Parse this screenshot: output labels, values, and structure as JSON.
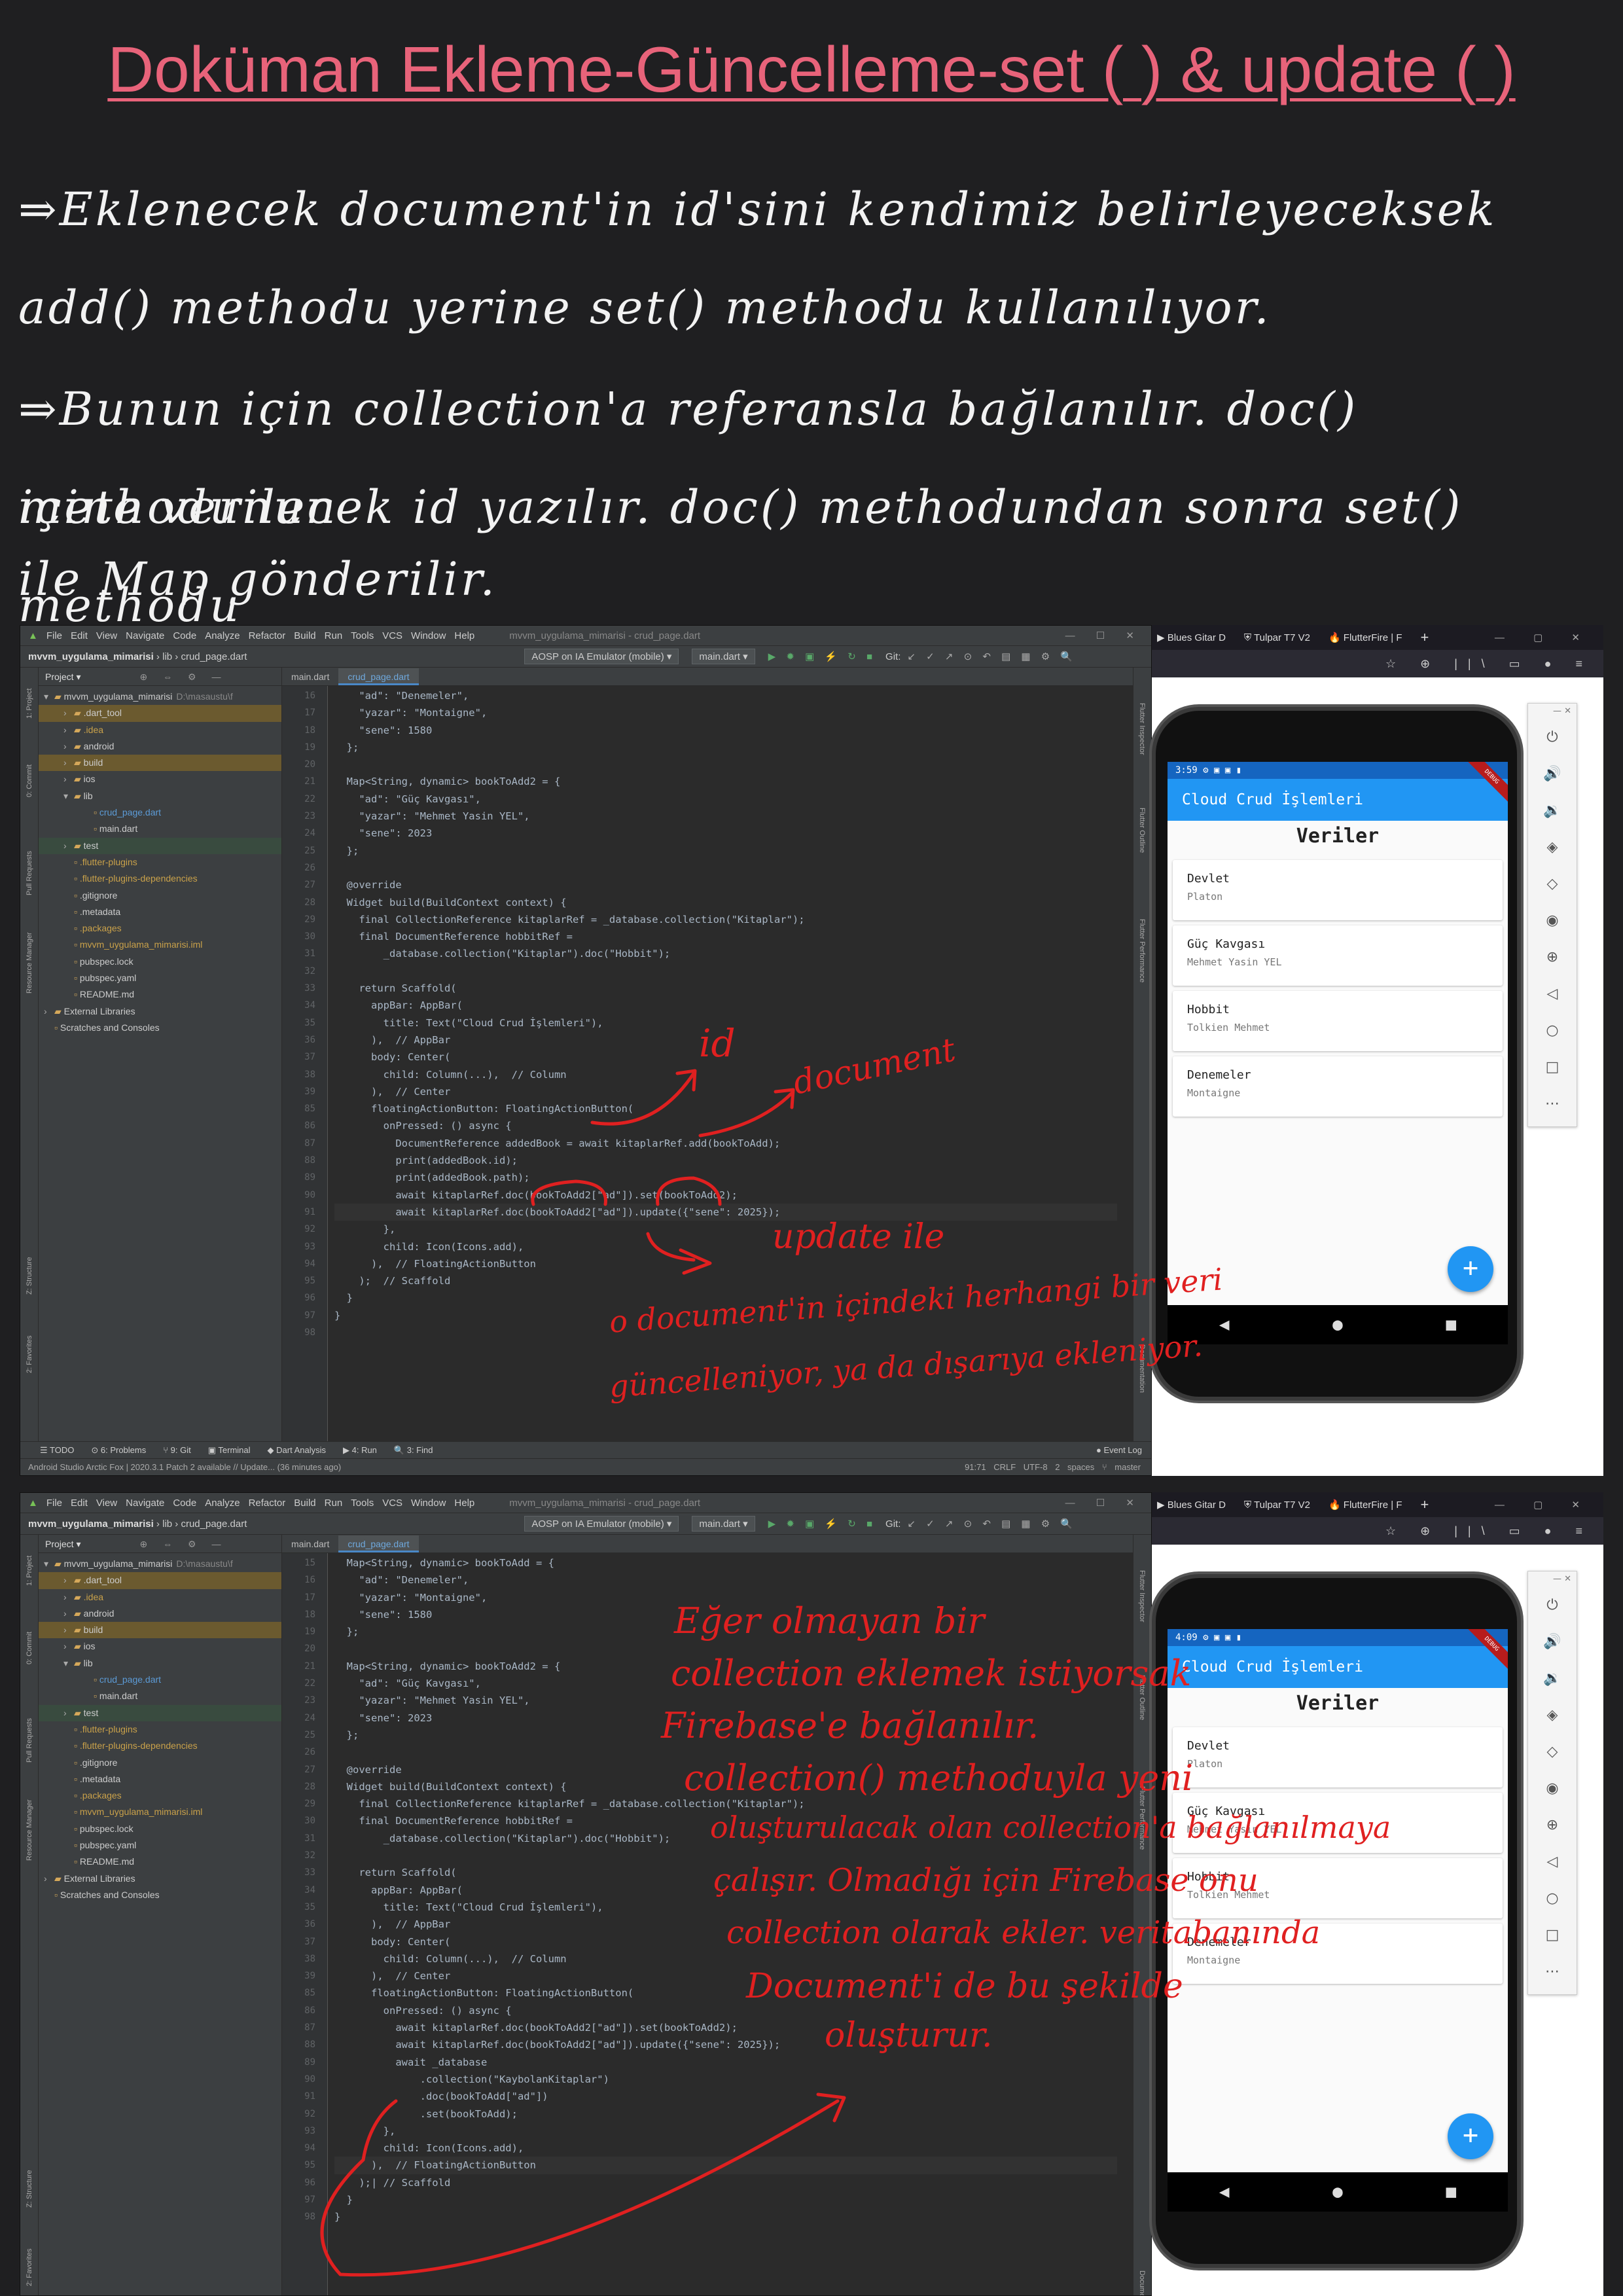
{
  "title": "Doküman Ekleme-Güncelleme-set ( ) & update ( )",
  "notes": [
    "⇒Eklenecek document'in id'sini kendimiz belirleyeceksek",
    "add() methodu yerine set() methodu kullanılıyor.",
    "⇒Bunun için collection'a referansla bağlanılır. doc() methodunun",
    "içine verilecek id yazılır. doc() methodundan sonra set() methodu",
    "ile Map gönderilir."
  ],
  "ide": {
    "menu": [
      "File",
      "Edit",
      "View",
      "Navigate",
      "Code",
      "Analyze",
      "Refactor",
      "Build",
      "Run",
      "Tools",
      "VCS",
      "Window",
      "Help"
    ],
    "window_title": "mvvm_uygulama_mimarisi - crud_page.dart",
    "window_controls": "—  ☐  ✕",
    "breadcrumb": {
      "project": "mvvm_uygulama_mimarisi",
      "folder": "lib",
      "file": "crud_page.dart"
    },
    "device": "AOSP on IA Emulator (mobile) ▾",
    "run_config": "main.dart ▾",
    "git_label": "Git:",
    "project_label": "Project ▾",
    "tabs": [
      "main.dart",
      "crud_page.dart"
    ],
    "side_tabs": [
      "1: Project",
      "0: Commit",
      "Pull Requests",
      "Resource Manager",
      "Z: Structure",
      "2: Favorites"
    ],
    "right_tabs": [
      "Flutter Inspector",
      "Flutter Outline",
      "Flutter Performance",
      "Documentation"
    ],
    "bottom_tools": [
      "☰ TODO",
      "⊙ 6: Problems",
      "⑂ 9: Git",
      "▣ Terminal",
      "◆ Dart Analysis",
      "▶ 4: Run",
      "🔍 3: Find"
    ],
    "event_log": "● Event Log",
    "status_left": "Android Studio Arctic Fox | 2020.3.1 Patch 2 available // Update... (36 minutes ago)",
    "status_right": "91:71  CRLF  UTF-8  2 spaces  ⑂ master",
    "tree": [
      {
        "label": "mvvm_uygulama_mimarisi",
        "path": "D:\\masaustu\\f",
        "indent": 0,
        "arrow": "▾",
        "style": "root"
      },
      {
        "label": ".dart_tool",
        "indent": 1,
        "arrow": "›",
        "style": "hl"
      },
      {
        "label": ".idea",
        "indent": 1,
        "arrow": "›",
        "style": "orange"
      },
      {
        "label": "android",
        "indent": 1,
        "arrow": "›",
        "style": "normal"
      },
      {
        "label": "build",
        "indent": 1,
        "arrow": "›",
        "style": "hl"
      },
      {
        "label": "ios",
        "indent": 1,
        "arrow": "›",
        "style": "normal"
      },
      {
        "label": "lib",
        "indent": 1,
        "arrow": "▾",
        "style": "normal"
      },
      {
        "label": "crud_page.dart",
        "indent": 2,
        "arrow": "",
        "style": "blue"
      },
      {
        "label": "main.dart",
        "indent": 2,
        "arrow": "",
        "style": "normal"
      },
      {
        "label": "test",
        "indent": 1,
        "arrow": "›",
        "style": "sel"
      },
      {
        "label": ".flutter-plugins",
        "indent": 1,
        "arrow": "",
        "style": "orange"
      },
      {
        "label": ".flutter-plugins-dependencies",
        "indent": 1,
        "arrow": "",
        "style": "orange"
      },
      {
        "label": ".gitignore",
        "indent": 1,
        "arrow": "",
        "style": "normal"
      },
      {
        "label": ".metadata",
        "indent": 1,
        "arrow": "",
        "style": "normal"
      },
      {
        "label": ".packages",
        "indent": 1,
        "arrow": "",
        "style": "orange"
      },
      {
        "label": "mvvm_uygulama_mimarisi.iml",
        "indent": 1,
        "arrow": "",
        "style": "orange"
      },
      {
        "label": "pubspec.lock",
        "indent": 1,
        "arrow": "",
        "style": "normal"
      },
      {
        "label": "pubspec.yaml",
        "indent": 1,
        "arrow": "",
        "style": "normal"
      },
      {
        "label": "README.md",
        "indent": 1,
        "arrow": "",
        "style": "normal"
      },
      {
        "label": "External Libraries",
        "indent": 0,
        "arrow": "›",
        "style": "normal"
      },
      {
        "label": "Scratches and Consoles",
        "indent": 0,
        "arrow": "",
        "style": "normal"
      }
    ]
  },
  "panel1": {
    "line_numbers": [
      "16",
      "17",
      "18",
      "19",
      "20",
      "21",
      "22",
      "23",
      "24",
      "25",
      "26",
      "27",
      "28",
      "29",
      "30",
      "31",
      "32",
      "33",
      "34",
      "35",
      "36",
      "37",
      "38",
      "39",
      "85",
      "86",
      "87",
      "88",
      "89",
      "90",
      "91",
      "92",
      "93",
      "94",
      "95",
      "96",
      "97",
      "98"
    ],
    "current_line": 30,
    "code": [
      "    \"ad\": \"Denemeler\",",
      "    \"yazar\": \"Montaigne\",",
      "    \"sene\": 1580",
      "  };",
      "",
      "  Map<String, dynamic> bookToAdd2 = {",
      "    \"ad\": \"Güç Kavgası\",",
      "    \"yazar\": \"Mehmet Yasin YEL\",",
      "    \"sene\": 2023",
      "  };",
      "",
      "  @override",
      "  Widget build(BuildContext context) {",
      "    final CollectionReference kitaplarRef = _database.collection(\"Kitaplar\");",
      "    final DocumentReference hobbitRef =",
      "        _database.collection(\"Kitaplar\").doc(\"Hobbit\");",
      "",
      "    return Scaffold(",
      "      appBar: AppBar(",
      "        title: Text(\"Cloud Crud İşlemleri\"),",
      "      ),  // AppBar",
      "      body: Center(",
      "        child: Column(...),  // Column",
      "      ),  // Center",
      "      floatingActionButton: FloatingActionButton(",
      "        onPressed: () async {",
      "          DocumentReference addedBook = await kitaplarRef.add(bookToAdd);",
      "          print(addedBook.id);",
      "          print(addedBook.path);",
      "          await kitaplarRef.doc(bookToAdd2[\"ad\"]).set(bookToAdd2);",
      "          await kitaplarRef.doc(bookToAdd2[\"ad\"]).update({\"sene\": 2025});",
      "        },",
      "        child: Icon(Icons.add),",
      "      ),  // FloatingActionButton",
      "    );  // Scaffold",
      "  }",
      "}",
      ""
    ],
    "annotations": {
      "id": "id",
      "document": "document",
      "update_line1": "update ile",
      "update_line2": "o document'in içindeki herhangi bir veri",
      "update_line3": "güncelleniyor, ya da dışarıya ekleniyor."
    }
  },
  "panel2": {
    "line_numbers": [
      "15",
      "16",
      "17",
      "18",
      "19",
      "20",
      "21",
      "22",
      "23",
      "24",
      "25",
      "26",
      "27",
      "28",
      "29",
      "30",
      "31",
      "32",
      "33",
      "34",
      "35",
      "36",
      "37",
      "38",
      "39",
      "85",
      "86",
      "87",
      "88",
      "89",
      "90",
      "91",
      "92",
      "93",
      "94",
      "95",
      "96",
      "97",
      "98"
    ],
    "current_line": 35,
    "code": [
      "  Map<String, dynamic> bookToAdd = {",
      "    \"ad\": \"Denemeler\",",
      "    \"yazar\": \"Montaigne\",",
      "    \"sene\": 1580",
      "  };",
      "",
      "  Map<String, dynamic> bookToAdd2 = {",
      "    \"ad\": \"Güç Kavgası\",",
      "    \"yazar\": \"Mehmet Yasin YEL\",",
      "    \"sene\": 2023",
      "  };",
      "",
      "  @override",
      "  Widget build(BuildContext context) {",
      "    final CollectionReference kitaplarRef = _database.collection(\"Kitaplar\");",
      "    final DocumentReference hobbitRef =",
      "        _database.collection(\"Kitaplar\").doc(\"Hobbit\");",
      "",
      "    return Scaffold(",
      "      appBar: AppBar(",
      "        title: Text(\"Cloud Crud İşlemleri\"),",
      "      ),  // AppBar",
      "      body: Center(",
      "        child: Column(...),  // Column",
      "      ),  // Center",
      "      floatingActionButton: FloatingActionButton(",
      "        onPressed: () async {",
      "          await kitaplarRef.doc(bookToAdd2[\"ad\"]).set(bookToAdd2);",
      "          await kitaplarRef.doc(bookToAdd2[\"ad\"]).update({\"sene\": 2025});",
      "          await _database",
      "              .collection(\"KaybolanKitaplar\")",
      "              .doc(bookToAdd[\"ad\"])",
      "              .set(bookToAdd);",
      "        },",
      "        child: Icon(Icons.add),",
      "      ),  // FloatingActionButton",
      "    );| // Scaffold",
      "  }",
      "}"
    ],
    "annotation_lines": [
      "Eğer olmayan bir",
      "collection eklemek istiyorsak",
      "Firebase'e bağlanılır.",
      "collection() methoduyla yeni",
      "oluşturulacak olan collection'a bağlanılmaya",
      "çalışır. Olmadığı için Firebase onu",
      "collection olarak ekler. veritabanında",
      "Document'i de bu şekilde",
      "oluşturur."
    ]
  },
  "browser": {
    "tabs": [
      "▶ Blues Gitar D",
      "⛨ Tulpar T7 V2",
      "🔥 FlutterFire | F"
    ],
    "plus": "+",
    "window_controls": "—  ▢  ✕",
    "nav_icons": "☆   ⊕ ||\\ ▭ ● ≡"
  },
  "phone1": {
    "clock": "3:59  ⚙ ▣ ▣ ▮"
  },
  "phone2": {
    "clock": "4:09  ⚙ ▣ ▣ ▮"
  },
  "app": {
    "appbar_title": "Cloud Crud İşlemleri",
    "debug_banner": "DEBUG",
    "section_title": "Veriler",
    "books": [
      {
        "title": "Devlet",
        "author": "Platon"
      },
      {
        "title": "Güç Kavgası",
        "author": "Mehmet Yasin YEL"
      },
      {
        "title": "Hobbit",
        "author": "Tolkien Mehmet"
      },
      {
        "title": "Denemeler",
        "author": "Montaigne"
      }
    ],
    "fab": "+",
    "nav": [
      "◀",
      "●",
      "■"
    ]
  },
  "emulator_tools": {
    "header": "—  ✕",
    "buttons": [
      "⏻",
      "🔊",
      "🔉",
      "◈",
      "◇",
      "◉",
      "⊕",
      "◁",
      "○",
      "□",
      "⋯"
    ]
  }
}
